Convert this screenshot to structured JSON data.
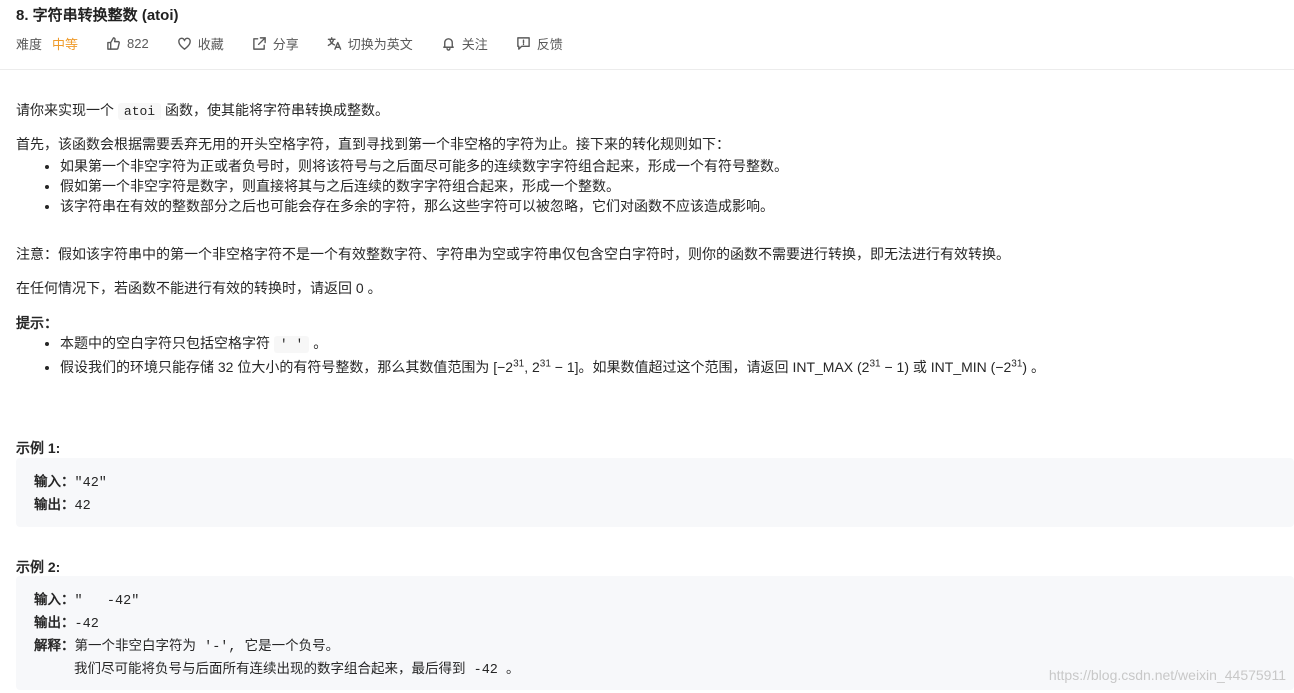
{
  "problem": {
    "title": "8. 字符串转换整数 (atoi)",
    "difficulty_label": "难度",
    "difficulty": "中等",
    "likes": "822",
    "favorite_label": "收藏",
    "share_label": "分享",
    "switch_lang_label": "切换为英文",
    "follow_label": "关注",
    "feedback_label": "反馈"
  },
  "description": {
    "p1_before": "请你来实现一个",
    "p1_code": "atoi",
    "p1_after": "函数，使其能将字符串转换成整数。",
    "p2": "首先，该函数会根据需要丢弃无用的开头空格字符，直到寻找到第一个非空格的字符为止。接下来的转化规则如下：",
    "rules": [
      "如果第一个非空字符为正或者负号时，则将该符号与之后面尽可能多的连续数字字符组合起来，形成一个有符号整数。",
      "假如第一个非空字符是数字，则直接将其与之后连续的数字字符组合起来，形成一个整数。",
      "该字符串在有效的整数部分之后也可能会存在多余的字符，那么这些字符可以被忽略，它们对函数不应该造成影响。"
    ],
    "note": "注意：假如该字符串中的第一个非空格字符不是一个有效整数字符、字符串为空或字符串仅包含空白字符时，则你的函数不需要进行转换，即无法进行有效转换。",
    "fallback": "在任何情况下，若函数不能进行有效的转换时，请返回 0 。",
    "hint_title": "提示：",
    "hint1_before": "本题中的空白字符只包括空格字符",
    "hint1_code": "' '",
    "hint1_after": "。",
    "hint2": {
      "t1": "假设我们的环境只能存储 32 位大小的有符号整数，那么其数值范围为 [−2",
      "e1": "31",
      "t2": ",  2",
      "e2": "31",
      "t3": " − 1]。如果数值超过这个范围，请返回  INT_MAX (2",
      "e3": "31",
      "t4": " − 1) 或 INT_MIN (−2",
      "e4": "31",
      "t5": ") 。"
    }
  },
  "examples": [
    {
      "title": "示例 1:",
      "input_label": "输入：",
      "input": "\"42\"",
      "output_label": "输出：",
      "output": "42"
    },
    {
      "title": "示例 2:",
      "input_label": "输入：",
      "input": "\"   -42\"",
      "output_label": "输出：",
      "output": "-42",
      "explain_label": "解释：",
      "explain1": "第一个非空白字符为 '-', 它是一个负号。",
      "explain2": "我们尽可能将负号与后面所有连续出现的数字组合起来，最后得到 -42 。"
    }
  ],
  "watermark": "https://blog.csdn.net/weixin_44575911"
}
